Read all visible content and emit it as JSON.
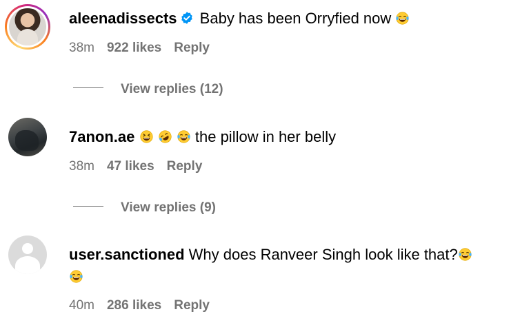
{
  "comments": [
    {
      "username": "aleenadissects",
      "verified": true,
      "text": "Baby has been Orryfied now",
      "emojis_after": [
        "face-with-tears-of-joy"
      ],
      "time": "38m",
      "likes": "922 likes",
      "reply_label": "Reply",
      "view_replies": "View replies (12)"
    },
    {
      "username": "7anon.ae",
      "verified": false,
      "emojis_before": [
        "grinning-squinting-face",
        "rolling-on-floor-laughing",
        "face-with-tears-of-joy"
      ],
      "text": "the pillow in her belly",
      "time": "38m",
      "likes": "47 likes",
      "reply_label": "Reply",
      "view_replies": "View replies (9)"
    },
    {
      "username": "user.sanctioned",
      "verified": false,
      "text": "Why does Ranveer Singh look like that?",
      "emojis_after": [
        "face-with-tears-of-joy",
        "face-with-tears-of-joy"
      ],
      "time": "40m",
      "likes": "286 likes",
      "reply_label": "Reply"
    }
  ],
  "colors": {
    "meta": "#737373",
    "verified": "#0095f6"
  }
}
